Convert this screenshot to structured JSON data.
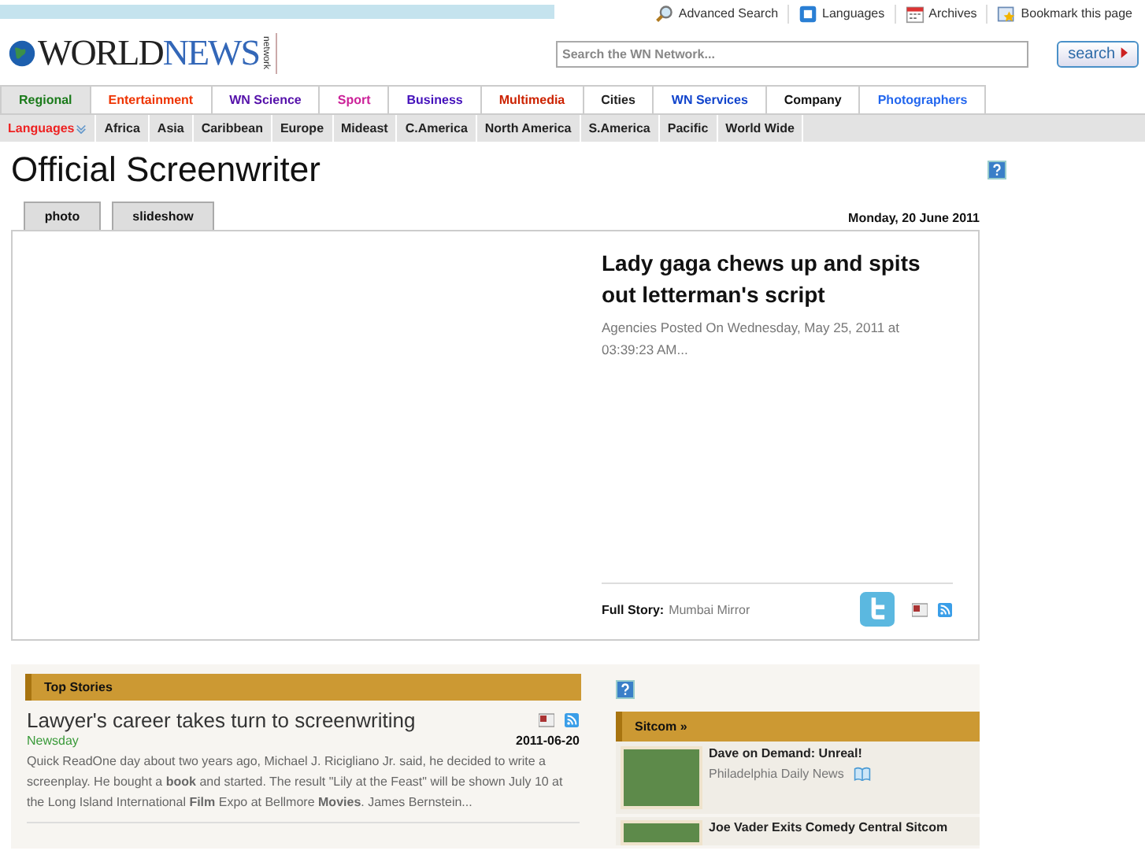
{
  "top_links": [
    {
      "kind": "search",
      "label": "Advanced Search"
    },
    {
      "kind": "languages",
      "label": "Languages"
    },
    {
      "kind": "calendar",
      "label": "Archives"
    },
    {
      "kind": "bookmark",
      "label": "Bookmark this page"
    }
  ],
  "logo": {
    "text": "WORLD ",
    "accent": "NEWS",
    "tag": "network"
  },
  "search": {
    "placeholder": "Search the WN Network...",
    "button": "search"
  },
  "nav": [
    {
      "label": "Regional",
      "color": "#1a7a1a",
      "selected": true
    },
    {
      "label": "Entertainment",
      "color": "#ee3300",
      "selected": false
    },
    {
      "label": "WN Science",
      "color": "#5511aa",
      "selected": false
    },
    {
      "label": "Sport",
      "color": "#cc2299",
      "selected": false
    },
    {
      "label": "Business",
      "color": "#4411bb",
      "selected": false
    },
    {
      "label": "Multimedia",
      "color": "#cc2200",
      "selected": false
    },
    {
      "label": "Cities",
      "color": "#222222",
      "selected": false
    },
    {
      "label": "WN Services",
      "color": "#1144cc",
      "selected": false
    },
    {
      "label": "Company",
      "color": "#111111",
      "selected": false
    },
    {
      "label": "Photographers",
      "color": "#2266ee",
      "selected": false
    }
  ],
  "subnav": {
    "languages": "Languages",
    "items": [
      "Africa",
      "Asia",
      "Caribbean",
      "Europe",
      "Mideast",
      "C.America",
      "North America",
      "S.America",
      "Pacific",
      "World Wide"
    ]
  },
  "page_title": "Official Screenwriter",
  "view_tabs": [
    {
      "label": "photo"
    },
    {
      "label": "slideshow"
    }
  ],
  "date": "Monday, 20 June 2011",
  "feature": {
    "headline": "Lady gaga chews up and spits out letterman's script",
    "meta": "Agencies Posted On Wednesday, May 25, 2011 at 03:39:23 AM...",
    "full_story_label": "Full Story:",
    "full_story_source": "Mumbai Mirror"
  },
  "top_stories": {
    "title": "Top Stories",
    "items": [
      {
        "headline": "Lawyer's career takes turn to screenwriting",
        "source": "Newsday",
        "date": "2011-06-20",
        "body": "Quick ReadOne day about two years ago, Michael J. Ricigliano Jr. said, he decided to write a screenplay. He bought a **book** and started. The result \"Lily at the Feast\" will be shown July 10 at the Long Island International **Film** Expo at Bellmore **Movies**. James Bernstein..."
      }
    ]
  },
  "sitcom": {
    "title": "Sitcom »",
    "items": [
      {
        "headline": "Dave on Demand: Unreal!",
        "source": "Philadelphia Daily News"
      },
      {
        "headline": "Joe Vader Exits Comedy Central Sitcom"
      }
    ]
  }
}
